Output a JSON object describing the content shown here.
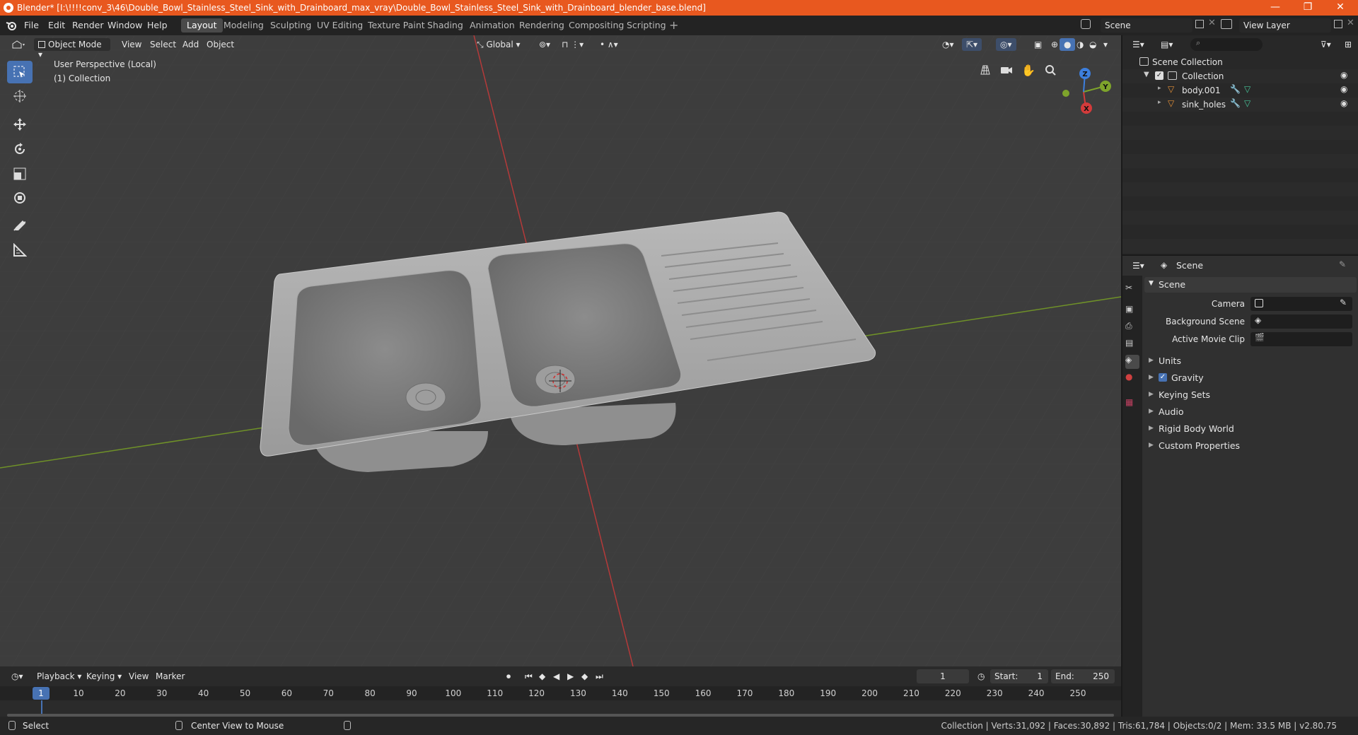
{
  "window": {
    "title": "Blender* [I:\\!!!!conv_3\\46\\Double_Bowl_Stainless_Steel_Sink_with_Drainboard_max_vray\\Double_Bowl_Stainless_Steel_Sink_with_Drainboard_blender_base.blend]",
    "minimize": "—",
    "restore": "❐",
    "close": "✕"
  },
  "menu": {
    "file": "File",
    "edit": "Edit",
    "render": "Render",
    "window": "Window",
    "help": "Help"
  },
  "workspaces": [
    "Layout",
    "Modeling",
    "Sculpting",
    "UV Editing",
    "Texture Paint",
    "Shading",
    "Animation",
    "Rendering",
    "Compositing",
    "Scripting"
  ],
  "scene_field": "Scene",
  "view_layer_field": "View Layer",
  "viewport": {
    "mode": "Object Mode",
    "menu_view": "View",
    "menu_select": "Select",
    "menu_add": "Add",
    "menu_object": "Object",
    "orientation": "Global",
    "perspective_label": "User Perspective (Local)",
    "collection_label": "(1) Collection",
    "gizmo": {
      "x": "X",
      "y": "Y",
      "z": "Z"
    }
  },
  "timeline": {
    "playback": "Playback",
    "keying": "Keying",
    "view": "View",
    "marker": "Marker",
    "current_frame": "1",
    "start_label": "Start:",
    "start_value": "1",
    "end_label": "End:",
    "end_value": "250",
    "ruler_current": "1",
    "ruler_ticks": [
      "10",
      "20",
      "30",
      "40",
      "50",
      "60",
      "70",
      "80",
      "90",
      "100",
      "110",
      "120",
      "130",
      "140",
      "150",
      "160",
      "170",
      "180",
      "190",
      "200",
      "210",
      "220",
      "230",
      "240",
      "250"
    ]
  },
  "outliner": {
    "scene_collection": "Scene Collection",
    "collection": "Collection",
    "objects": [
      "body.001",
      "sink_holes"
    ]
  },
  "properties": {
    "header": "Scene",
    "panel_title": "Scene",
    "camera_label": "Camera",
    "background_scene_label": "Background Scene",
    "active_movie_clip_label": "Active Movie Clip",
    "sections": [
      "Units",
      "Gravity",
      "Keying Sets",
      "Audio",
      "Rigid Body World",
      "Custom Properties"
    ]
  },
  "statusbar": {
    "select": "Select",
    "center_view": "Center View to Mouse",
    "stats": "Collection | Verts:31,092 | Faces:30,892 | Tris:61,784 | Objects:0/2 | Mem: 33.5 MB | v2.80.75"
  },
  "colors": {
    "titlebar": "#e8581f",
    "accent": "#4772b3",
    "axis_x": "#d33b3b",
    "axis_y": "#7ea42b",
    "axis_z": "#3d7fde"
  }
}
